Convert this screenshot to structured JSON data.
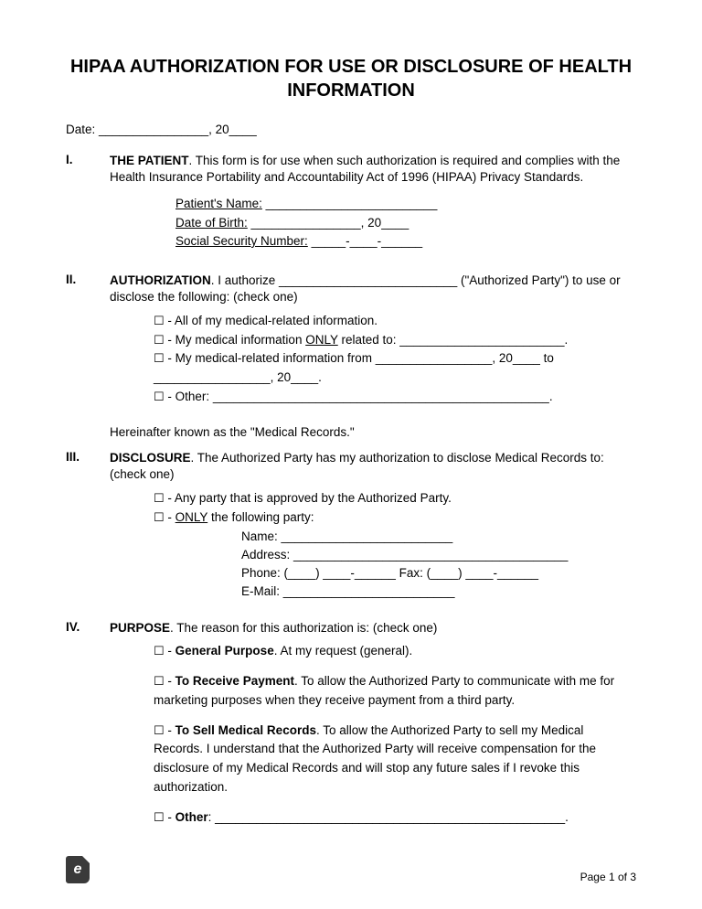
{
  "title": "HIPAA AUTHORIZATION FOR USE OR DISCLOSURE OF HEALTH INFORMATION",
  "dateLine": "Date: ________________, 20____",
  "s1": {
    "num": "I.",
    "head": "THE PATIENT",
    "text": ". This form is for use when such authorization is required and complies with the Health Insurance Portability and Accountability Act of 1996 (HIPAA) Privacy Standards.",
    "f1a": "Patient's Name:",
    "f1b": " _________________________",
    "f2a": "Date of Birth:",
    "f2b": "   ________________, 20____",
    "f3a": "Social Security Number:",
    "f3b": " _____-____-______"
  },
  "s2": {
    "num": "II.",
    "head": "AUTHORIZATION",
    "text": ". I authorize __________________________ (\"Authorized Party\") to use or disclose the following: (check one)",
    "o1": " - All of my medical-related information.",
    "o2a": " - My medical information ",
    "o2u": "ONLY",
    "o2b": " related to: ________________________.",
    "o3": " - My medical-related information from _________________, 20____ to _________________, 20____.",
    "o4": " - Other: _________________________________________________.",
    "tail": "Hereinafter known as the \"Medical Records.\""
  },
  "s3": {
    "num": "III.",
    "head": "DISCLOSURE",
    "text": ". The Authorized Party has my authorization to disclose Medical Records to: (check one)",
    "o1": " - Any party that is approved by the Authorized Party.",
    "o2a": " - ",
    "o2u": "ONLY",
    "o2b": " the following party:",
    "name": "Name: _________________________",
    "addr": "Address: ________________________________________",
    "phone": "Phone: (____) ____-______ Fax: (____) ____-______",
    "email": "E-Mail: _________________________"
  },
  "s4": {
    "num": "IV.",
    "head": "PURPOSE",
    "text": ". The reason for this authorization is: (check one)",
    "o1b": "General Purpose",
    "o1t": ". At my request (general).",
    "o2b": "To Receive Payment",
    "o2t": ". To allow the Authorized Party to communicate with me for marketing purposes when they receive payment from a third party.",
    "o3b": "To Sell Medical Records",
    "o3t": ". To allow the Authorized Party to sell my Medical Records. I understand that the Authorized Party will receive compensation for the disclosure of my Medical Records and will stop any future sales if I revoke this authorization.",
    "o4b": "Other",
    "o4t": ": ___________________________________________________."
  },
  "cb": "☐",
  "logo": "e",
  "pageNum": "Page 1 of 3"
}
